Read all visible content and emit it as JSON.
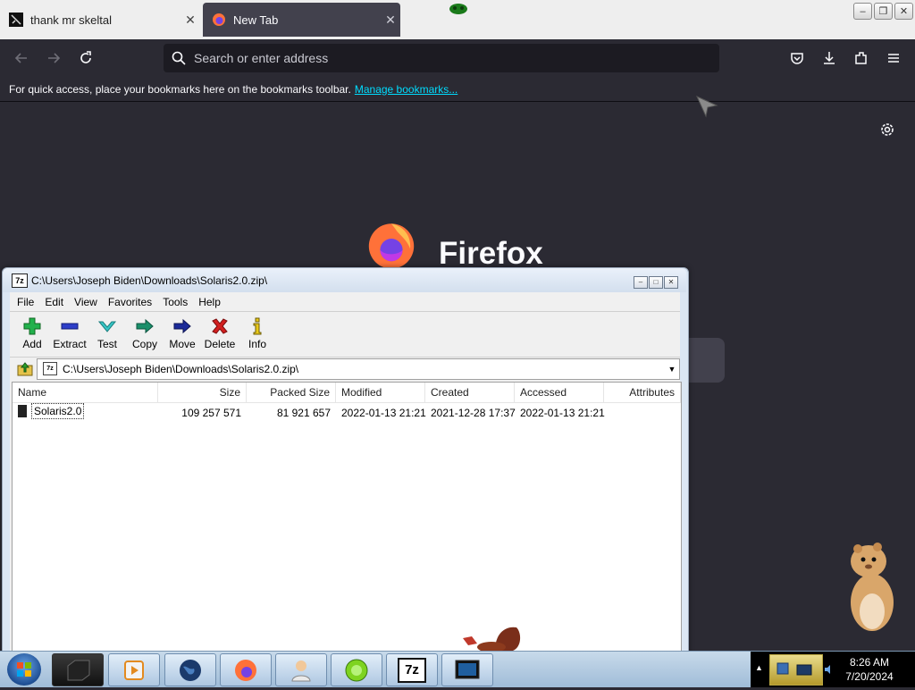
{
  "browser": {
    "tabs": [
      {
        "title": "thank mr skeltal",
        "close": "✕"
      },
      {
        "title": "New Tab",
        "close": "✕"
      }
    ],
    "address_placeholder": "Search or enter address",
    "bookmarks_message": "For quick access, place your bookmarks here on the bookmarks toolbar.",
    "bookmarks_link": "Manage bookmarks...",
    "wordmark": "Firefox"
  },
  "archive_window": {
    "title": "C:\\Users\\Joseph Biden\\Downloads\\Solaris2.0.zip\\",
    "menu": [
      "File",
      "Edit",
      "View",
      "Favorites",
      "Tools",
      "Help"
    ],
    "toolbar": [
      "Add",
      "Extract",
      "Test",
      "Copy",
      "Move",
      "Delete",
      "Info"
    ],
    "path": "C:\\Users\\Joseph Biden\\Downloads\\Solaris2.0.zip\\",
    "columns": [
      "Name",
      "Size",
      "Packed Size",
      "Modified",
      "Created",
      "Accessed",
      "Attributes"
    ],
    "rows": [
      {
        "name": "Solaris2.0",
        "size": "109 257 571",
        "packed": "81 921 657",
        "modified": "2022-01-13 21:21",
        "created": "2021-12-28 17:37",
        "accessed": "2022-01-13 21:21",
        "attributes": ""
      }
    ]
  },
  "taskbar": {
    "items": [
      "media-player",
      "globe",
      "firefox",
      "user-contact",
      "green-ball",
      "7zip",
      "monitor"
    ],
    "app_label_7z": "7z",
    "time": "8:26 AM",
    "date": "7/20/2024"
  },
  "colors": {
    "browser_bg": "#2b2a33",
    "link": "#00ddff",
    "taskbar": "#a9c3dc"
  }
}
